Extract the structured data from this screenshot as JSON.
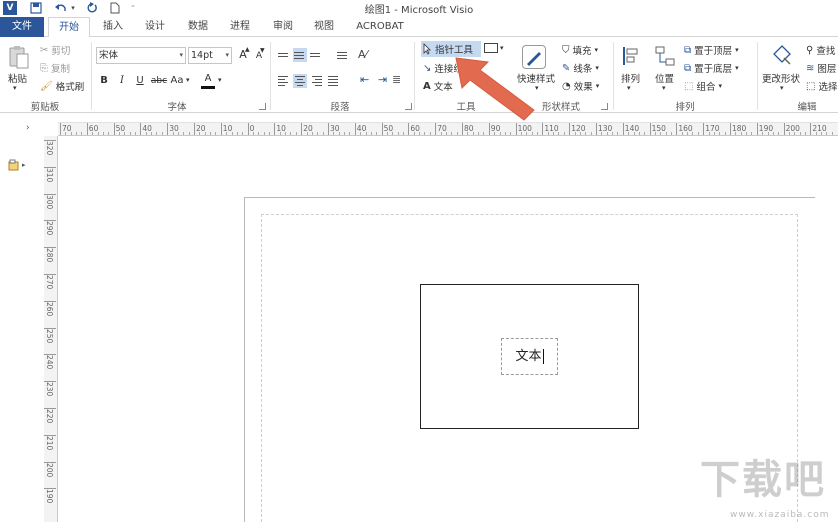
{
  "app": {
    "title": "绘图1 - Microsoft Visio",
    "logo_text": "V",
    "accent_color": "#2b579a",
    "arrow_color": "#e26a4f"
  },
  "quick_access": {
    "icons": [
      "save-icon",
      "undo-icon",
      "redo-icon",
      "new-document-icon",
      "customize-qat-icon"
    ]
  },
  "tabs": [
    {
      "label": "文件",
      "active": false
    },
    {
      "label": "开始",
      "active": true
    },
    {
      "label": "插入",
      "active": false
    },
    {
      "label": "设计",
      "active": false
    },
    {
      "label": "数据",
      "active": false
    },
    {
      "label": "进程",
      "active": false
    },
    {
      "label": "审阅",
      "active": false
    },
    {
      "label": "视图",
      "active": false
    },
    {
      "label": "ACROBAT",
      "active": false
    }
  ],
  "ribbon": {
    "clipboard": {
      "label": "剪贴板",
      "paste": "粘贴",
      "cut": "剪切",
      "copy": "复制",
      "format_painter": "格式刷"
    },
    "font": {
      "label": "字体",
      "font_name": "宋体",
      "font_size": "14pt",
      "bold": "B",
      "italic": "I",
      "underline": "U",
      "strikethrough": "abc",
      "case": "Aa",
      "font_color": "A",
      "grow": "A",
      "shrink": "A"
    },
    "paragraph": {
      "label": "段落"
    },
    "tools": {
      "label": "工具",
      "pointer": "指针工具",
      "connector": "连接线",
      "text": "文本"
    },
    "shape_styles": {
      "label": "形状样式",
      "quick_styles": "快速样式",
      "fill": "填充",
      "line": "线条",
      "effects": "效果"
    },
    "arrange": {
      "label": "排列",
      "arrange": "排列",
      "position": "位置",
      "bring_front": "置于顶层",
      "send_back": "置于底层",
      "group": "组合"
    },
    "editing": {
      "label": "编辑",
      "change_shape": "更改形状",
      "find": "查找",
      "layers": "图层",
      "select": "选择"
    }
  },
  "ruler": {
    "horizontal": [
      "70",
      "60",
      "50",
      "40",
      "30",
      "20",
      "10",
      "0",
      "10",
      "20",
      "30",
      "40",
      "50",
      "60",
      "70",
      "80",
      "90",
      "100",
      "110",
      "120",
      "130",
      "140",
      "150",
      "160",
      "170",
      "180",
      "190",
      "200",
      "210"
    ],
    "vertical": [
      "320",
      "310",
      "300",
      "290",
      "280",
      "270",
      "260",
      "250",
      "240",
      "230",
      "220",
      "210",
      "200",
      "190"
    ]
  },
  "canvas": {
    "shape_text": "文本"
  },
  "watermark": {
    "big": "下载吧",
    "small": "www.xiazaiba.com"
  }
}
